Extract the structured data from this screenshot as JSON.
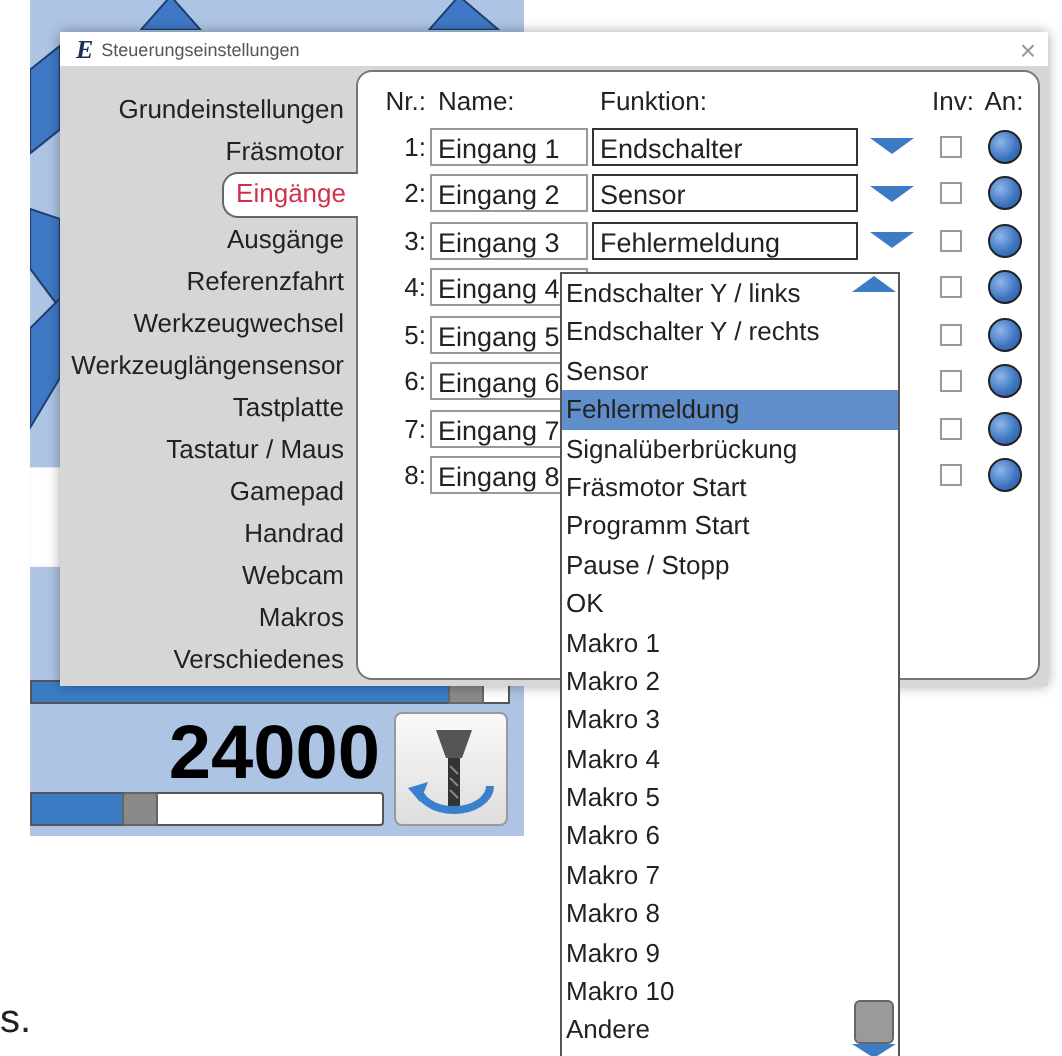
{
  "background_app": {
    "spindle_bar": {
      "level": 0.95
    },
    "speed": "24000",
    "speed_slider": {
      "level": 0.3
    }
  },
  "dialog": {
    "logo": "E",
    "title": "Steuerungseinstellungen",
    "close": "×",
    "sidebar": {
      "items": [
        {
          "label": "Grundeinstellungen",
          "selected": false
        },
        {
          "label": "Fräsmotor",
          "selected": false
        },
        {
          "label": "Eingänge",
          "selected": true
        },
        {
          "label": "Ausgänge",
          "selected": false
        },
        {
          "label": "Referenzfahrt",
          "selected": false
        },
        {
          "label": "Werkzeugwechsel",
          "selected": false
        },
        {
          "label": "Werkzeuglängensensor",
          "selected": false
        },
        {
          "label": "Tastplatte",
          "selected": false
        },
        {
          "label": "Tastatur / Maus",
          "selected": false
        },
        {
          "label": "Gamepad",
          "selected": false
        },
        {
          "label": "Handrad",
          "selected": false
        },
        {
          "label": "Webcam",
          "selected": false
        },
        {
          "label": "Makros",
          "selected": false
        },
        {
          "label": "Verschiedenes",
          "selected": false
        }
      ]
    },
    "columns": [
      "Nr.:",
      "Name:",
      "Funktion:",
      "Inv:",
      "An:"
    ],
    "rows": [
      {
        "nr": "1:",
        "name": "Eingang 1",
        "function": "Endschalter",
        "inv": false,
        "on": true
      },
      {
        "nr": "2:",
        "name": "Eingang 2",
        "function": "Sensor",
        "inv": false,
        "on": true
      },
      {
        "nr": "3:",
        "name": "Eingang 3",
        "function": "Fehlermeldung",
        "inv": false,
        "on": true
      },
      {
        "nr": "4:",
        "name": "Eingang 4",
        "inv": false,
        "on": true
      },
      {
        "nr": "5:",
        "name": "Eingang 5",
        "inv": false,
        "on": true
      },
      {
        "nr": "6:",
        "name": "Eingang 6",
        "inv": false,
        "on": true
      },
      {
        "nr": "7:",
        "name": "Eingang 7",
        "inv": false,
        "on": true
      },
      {
        "nr": "8:",
        "name": "Eingang 8",
        "inv": false,
        "on": true
      }
    ]
  },
  "dropdown": {
    "items": [
      {
        "label": "Endschalter Y / links",
        "selected": false
      },
      {
        "label": "Endschalter Y / rechts",
        "selected": false
      },
      {
        "label": "Sensor",
        "selected": false
      },
      {
        "label": "Fehlermeldung",
        "selected": true
      },
      {
        "label": "Signalüberbrückung",
        "selected": false
      },
      {
        "label": "Fräsmotor Start",
        "selected": false
      },
      {
        "label": "Programm Start",
        "selected": false
      },
      {
        "label": "Pause / Stopp",
        "selected": false
      },
      {
        "label": "OK",
        "selected": false
      },
      {
        "label": "Makro 1",
        "selected": false
      },
      {
        "label": "Makro 2",
        "selected": false
      },
      {
        "label": "Makro 3",
        "selected": false
      },
      {
        "label": "Makro 4",
        "selected": false
      },
      {
        "label": "Makro 5",
        "selected": false
      },
      {
        "label": "Makro 6",
        "selected": false
      },
      {
        "label": "Makro 7",
        "selected": false
      },
      {
        "label": "Makro 8",
        "selected": false
      },
      {
        "label": "Makro 9",
        "selected": false
      },
      {
        "label": "Makro 10",
        "selected": false
      },
      {
        "label": "Andere",
        "selected": false
      }
    ]
  },
  "fragment": "s."
}
